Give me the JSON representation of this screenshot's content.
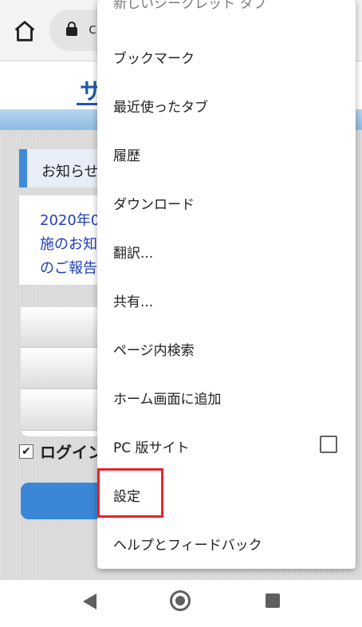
{
  "browser": {
    "url_fragment": "c"
  },
  "page": {
    "logo_fragment": "サ",
    "notice_title": "お知らせ",
    "notice_lines": [
      "2020年0",
      "施のお知",
      "のご報告"
    ],
    "login_label": "ログイン"
  },
  "menu": {
    "items": [
      {
        "label": "新しいシークレット タブ"
      },
      {
        "label": "ブックマーク"
      },
      {
        "label": "最近使ったタブ"
      },
      {
        "label": "履歴"
      },
      {
        "label": "ダウンロード"
      },
      {
        "label": "翻訳..."
      },
      {
        "label": "共有..."
      },
      {
        "label": "ページ内検索"
      },
      {
        "label": "ホーム画面に追加"
      },
      {
        "label": "PC 版サイト"
      },
      {
        "label": "設定"
      },
      {
        "label": "ヘルプとフィードバック"
      }
    ],
    "pc_site_checked": false,
    "highlighted_item": "設定",
    "highlight_color": "#e5232a"
  },
  "icons": {
    "home": "home-icon",
    "lock": "lock-icon",
    "checkbox": "checkbox-icon",
    "back": "back-icon",
    "nav_home": "nav-home-icon",
    "recents": "recents-icon"
  }
}
